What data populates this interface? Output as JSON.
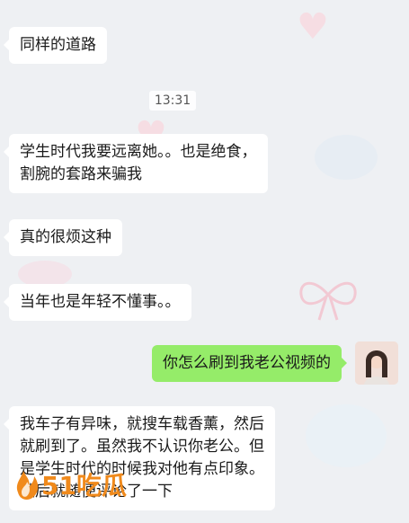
{
  "chat": {
    "messages": [
      {
        "side": "in",
        "lines": [
          "同样的道路"
        ]
      },
      {
        "side": "in",
        "lines": [
          "学生时代我要远离她。。也是绝食，",
          "割腕的套路来骗我"
        ]
      },
      {
        "side": "in",
        "lines": [
          "真的很烦这种"
        ]
      },
      {
        "side": "in",
        "lines": [
          "当年也是年轻不懂事。。"
        ]
      },
      {
        "side": "out",
        "lines": [
          "你怎么刷到我老公视频的"
        ]
      },
      {
        "side": "in",
        "lines": [
          "我车子有异味，就搜车载香薰，然后",
          "就刷到了。虽然我不认识你老公。但",
          "是学生时代的时候我对他有点印象。",
          "然后就随便评论了一下"
        ]
      }
    ],
    "timestamp": "13:31"
  },
  "colors": {
    "incoming_bubble": "#ffffff",
    "outgoing_bubble": "#95ec69",
    "background": "#eef0f3",
    "watermark": "#f08a1c"
  },
  "watermark": {
    "text": "51吃瓜",
    "icon": "flame-logo-icon"
  }
}
